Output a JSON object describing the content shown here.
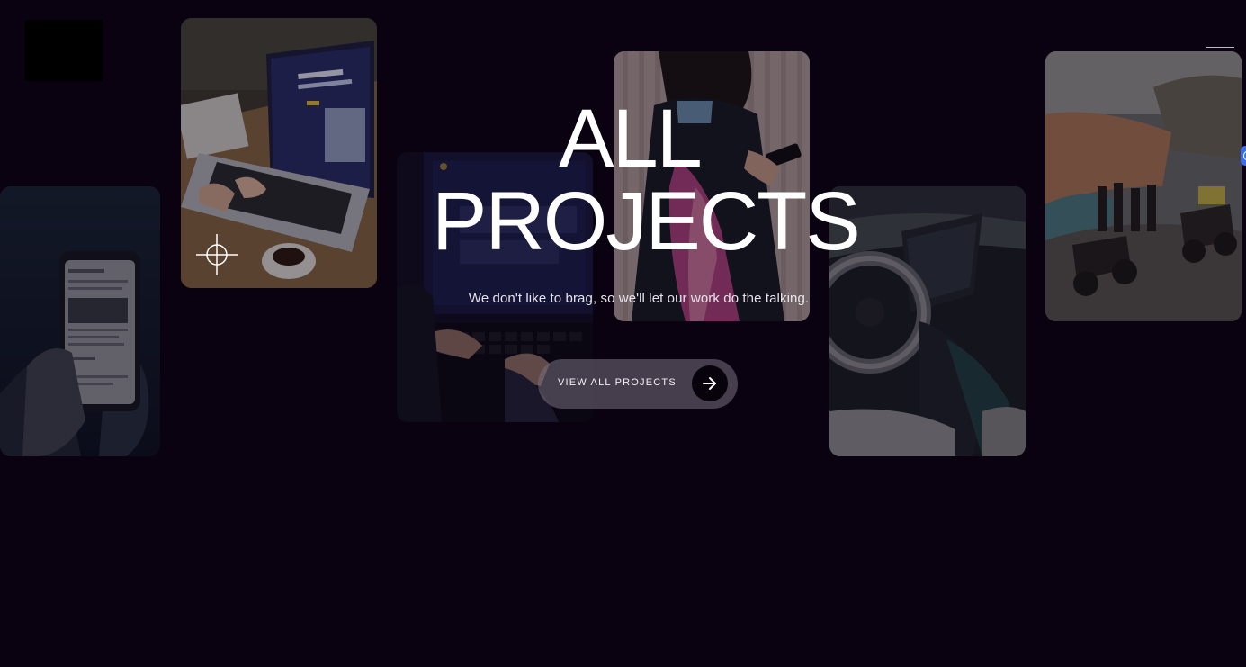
{
  "hero": {
    "title_line1": "ALL",
    "title_line2": "PROJECTS",
    "subtitle": "We don't like to brag, so we'll let our work do the talking."
  },
  "cta": {
    "label": "VIEW ALL PROJECTS",
    "icon": "arrow-right-icon"
  },
  "header": {
    "menu_icon": "hamburger-menu-icon"
  },
  "colors": {
    "background": "#0a0210",
    "text": "#ffffff",
    "button_bg": "#787080",
    "arrow_circle": "#08020c"
  }
}
